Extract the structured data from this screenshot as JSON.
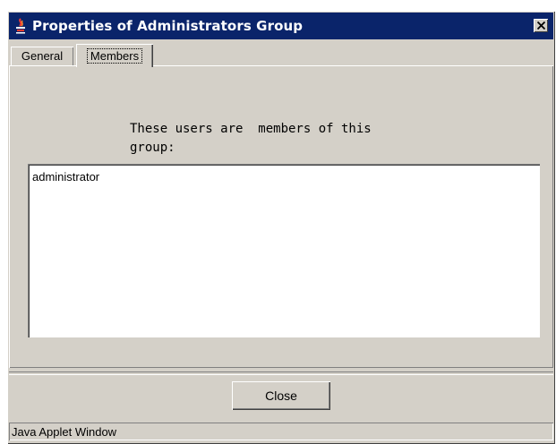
{
  "window": {
    "title": "Properties of Administrators Group",
    "title_icon": "java-cup-icon",
    "close_icon": "close-x-icon",
    "titlebar_color": "#0a246a",
    "background_color": "#d4d0c8"
  },
  "tabs": [
    {
      "label": "General",
      "selected": false
    },
    {
      "label": "Members",
      "selected": true
    }
  ],
  "members_panel": {
    "description": "These users are  members of this\ngroup:",
    "members": [
      "administrator"
    ]
  },
  "buttons": {
    "close_label": "Close"
  },
  "status": {
    "text": "Java Applet Window"
  }
}
